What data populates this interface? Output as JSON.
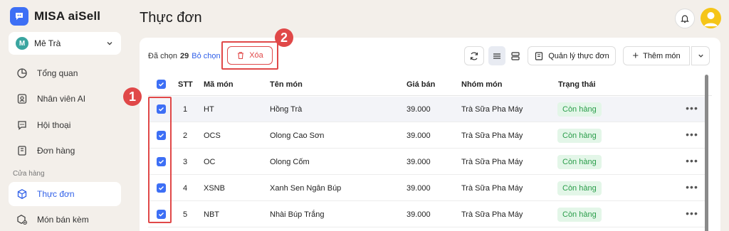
{
  "brand": {
    "name": "MISA aiSell"
  },
  "store": {
    "initial": "M",
    "name": "Mê Trà"
  },
  "nav": {
    "items": [
      {
        "label": "Tổng quan",
        "icon": "pie-chart-icon"
      },
      {
        "label": "Nhân viên AI",
        "icon": "person-badge-icon"
      },
      {
        "label": "Hội thoại",
        "icon": "chat-icon"
      },
      {
        "label": "Đơn hàng",
        "icon": "order-icon"
      }
    ],
    "section_label": "Cửa hàng",
    "store_items": [
      {
        "label": "Thực đơn",
        "icon": "box-icon",
        "active": true
      },
      {
        "label": "Món bán kèm",
        "icon": "box-plus-icon",
        "active": false
      }
    ]
  },
  "page": {
    "title": "Thực đơn"
  },
  "toolbar": {
    "selected_prefix": "Đã chọn",
    "selected_count": "29",
    "deselect_label": "Bỏ chọn",
    "delete_label": "Xóa",
    "manage_menu_label": "Quản lý thực đơn",
    "add_item_label": "Thêm món"
  },
  "annotations": {
    "marker1": "1",
    "marker2": "2",
    "color": "#e04848"
  },
  "table": {
    "columns": [
      "STT",
      "Mã món",
      "Tên món",
      "Giá bán",
      "Nhóm món",
      "Trạng thái"
    ],
    "rows": [
      {
        "stt": "1",
        "code": "HT",
        "name": "Hồng Trà",
        "price": "39.000",
        "group": "Trà Sữa Pha Máy",
        "status": "Còn hàng"
      },
      {
        "stt": "2",
        "code": "OCS",
        "name": "Olong Cao Sơn",
        "price": "39.000",
        "group": "Trà Sữa Pha Máy",
        "status": "Còn hàng"
      },
      {
        "stt": "3",
        "code": "OC",
        "name": "Olong Cốm",
        "price": "39.000",
        "group": "Trà Sữa Pha Máy",
        "status": "Còn hàng"
      },
      {
        "stt": "4",
        "code": "XSNB",
        "name": "Xanh Sen Ngân Búp",
        "price": "39.000",
        "group": "Trà Sữa Pha Máy",
        "status": "Còn hàng"
      },
      {
        "stt": "5",
        "code": "NBT",
        "name": "Nhài Búp Trắng",
        "price": "39.000",
        "group": "Trà Sữa Pha Máy",
        "status": "Còn hàng"
      }
    ]
  },
  "colors": {
    "accent": "#3d6ff5",
    "danger": "#e04848",
    "status_bg": "#e3f6e8",
    "status_text": "#2a9d4a"
  }
}
